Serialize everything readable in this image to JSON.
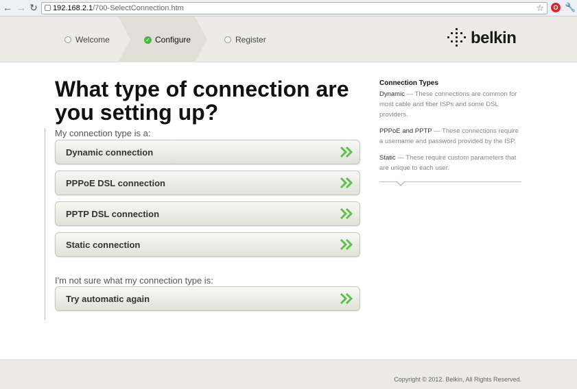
{
  "browser": {
    "url_host": "192.168.2.1",
    "url_path": "/700-SelectConnection.htm",
    "ext_label": "O"
  },
  "steps": [
    {
      "label": "Welcome"
    },
    {
      "label": "Configure"
    },
    {
      "label": "Register"
    }
  ],
  "brand": {
    "name": "belkin"
  },
  "main": {
    "title": "What type of connection are you setting up?",
    "type_label": "My connection type is a:",
    "options": [
      {
        "label": "Dynamic connection"
      },
      {
        "label": "PPPoE DSL connection"
      },
      {
        "label": "PPTP DSL connection"
      },
      {
        "label": "Static connection"
      }
    ],
    "unsure_label": "I'm not sure what my connection type is:",
    "retry_label": "Try automatic again"
  },
  "sidebar": {
    "title": "Connection Types",
    "dynamic_term": "Dynamic",
    "dynamic_desc": " — These connections are common for most cable and fiber ISPs and some DSL providers.",
    "pppoe_term": "PPPoE",
    "and_word": " and ",
    "pptp_term": "PPTP",
    "pppoe_desc": " — These connections require a username and password provided by the ISP.",
    "static_term": "Static",
    "static_desc": " — These require custom parameters that are unique to each user."
  },
  "footer": {
    "copyright": "Copyright © 2012. Belkin, All Rights Reserved."
  },
  "colors": {
    "accent_green": "#4cb748",
    "chevron_green": "#5fc04a"
  }
}
